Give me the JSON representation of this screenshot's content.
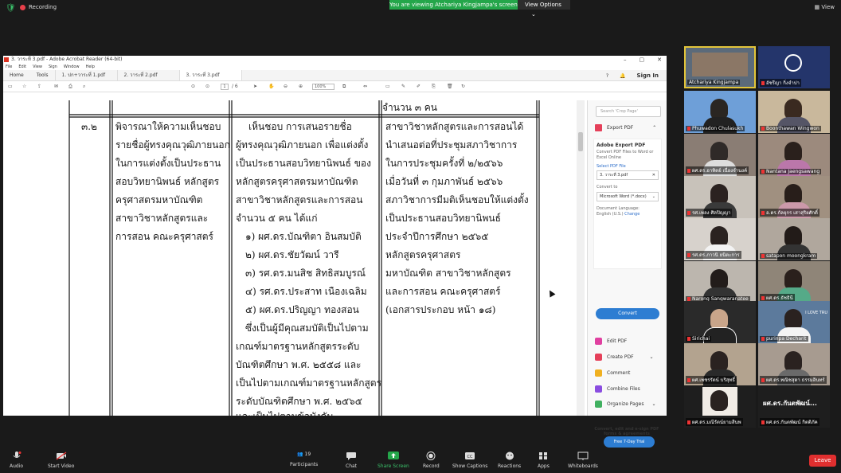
{
  "zoom": {
    "recording_label": "Recording",
    "share_banner": "You are viewing Atchariya Kingjampa's screen",
    "view_options": "View Options",
    "view_label": "View",
    "bottom_bar": {
      "audio": "Audio",
      "video": "Start Video",
      "participants": "Participants",
      "participants_count": "19",
      "chat": "Chat",
      "share": "Share Screen",
      "record": "Record",
      "captions": "Show Captions",
      "reactions": "Reactions",
      "apps": "Apps",
      "whiteboards": "Whiteboards",
      "leave": "Leave"
    },
    "participants": [
      {
        "name": "Atchariya Kingjampa"
      },
      {
        "name": "อัชรีญา กิ่งจำปา"
      },
      {
        "name": "Phuwadon Chulasukh"
      },
      {
        "name": "Boonthawan Wingwon"
      },
      {
        "name": "ผศ.ดร.อาทิตย์ เนื่องจำนงค์"
      },
      {
        "name": "Nantana Jaengsawang"
      },
      {
        "name": "รศ.เพลง ศิลปิญญา"
      },
      {
        "name": "อ.ดร.กัลยุกร เสาสุริยศักดิ์"
      },
      {
        "name": "รศ.ดร.ภาวนิ ยนิตะการ"
      },
      {
        "name": "satapon moongkram"
      },
      {
        "name": "Narong Sangwaranatee"
      },
      {
        "name": "ผศ.ดร.ธัชธินี"
      },
      {
        "name": "Sirichai"
      },
      {
        "name": "purinpa Decharit"
      },
      {
        "name": "ผศ.เพชรรัตน์ บริสุทธิ์"
      },
      {
        "name": "ผศ.ดร.พณิชสุดา ธรรมอินทร์"
      },
      {
        "name": "ผศ.ดร.มณีรัตน์ยามสีนพ"
      },
      {
        "name": "ผศ.ดร.กันตพัฒน์ กิตติภัค"
      }
    ],
    "participant_tile_text": {
      "love": "I LOVE TRU",
      "initials": "ผศ.ดร.กันตพัฒน์..."
    }
  },
  "acrobat": {
    "window_title": "3. วาระที่ 3.pdf - Adobe Acrobat Reader (64-bit)",
    "menu": [
      "File",
      "Edit",
      "View",
      "Sign",
      "Window",
      "Help"
    ],
    "nav": [
      "Home",
      "Tools"
    ],
    "tabs": [
      "1. ปก+วาระที่ 1.pdf",
      "2. วาระที่ 2.pdf",
      "3. วาระที่ 3.pdf"
    ],
    "sign_in": "Sign In",
    "page_current": "1",
    "page_total": "/ 6",
    "zoom": "100%",
    "right_pane": {
      "search_placeholder": "Search 'Crop Page'",
      "export_pdf": "Export PDF",
      "box_title": "Adobe Export PDF",
      "box_subtitle": "Convert PDF Files to Word or Excel Online",
      "select_label": "Select PDF File",
      "file_name": "3. วาระที่ 3.pdf",
      "convert_to": "Convert to",
      "format": "Microsoft Word (*.docx)",
      "doc_language": "Document Language:",
      "language_value": "English (U.S.)",
      "change": "Change",
      "convert_button": "Convert",
      "tools": [
        "Edit PDF",
        "Create PDF",
        "Comment",
        "Combine Files",
        "Organize Pages"
      ],
      "promo": "Convert, edit and e-sign PDF forms & agreements",
      "trial": "Free 7-Day Trial"
    }
  },
  "document": {
    "col3_top": "จำนวน ๓ คน",
    "item_no": "๓.๒",
    "col1_lines": [
      "พิจารณาให้ความเห็นชอบ",
      "รายชื่อผู้ทรงคุณวุฒิภายนอก",
      "ในการแต่งตั้งเป็นประธาน",
      "สอบวิทยานิพนธ์ หลักสูตร",
      "ครุศาสตรมหาบัณฑิต",
      "สาขาวิชาหลักสูตรและ",
      "การสอน คณะครุศาสตร์"
    ],
    "col2_lines": [
      "เห็นชอบ การเสนอรายชื่อ",
      "ผู้ทรงคุณวุฒิภายนอก เพื่อแต่งตั้ง",
      "เป็นประธานสอบวิทยานิพนธ์ ของ",
      "หลักสูตรครุศาสตรมหาบัณฑิต",
      "สาขาวิชาหลักสูตรและการสอน",
      "จำนวน ๕ คน ได้แก่"
    ],
    "col2_list": [
      "๑) ผศ.ดร.บัณฑิตา  อินสมบัติ",
      "๒) ผศ.ดร.ชัยวัฒน์  วารี",
      "๓) รศ.ดร.มนสิช  สิทธิสมบูรณ์",
      "๔) รศ.ดร.ประสาท  เนืองเฉลิม",
      "๕) ผศ.ดร.ปริญญา  ทองสอน"
    ],
    "col2_tail": [
      "ซึ่งเป็นผู้มีคุณสมบัติเป็นไปตาม",
      "เกณฑ์มาตรฐานหลักสูตรระดับ",
      "บัณฑิตศึกษา พ.ศ. ๒๕๕๘ และ",
      "เป็นไปตามเกณฑ์มาตรฐานหลักสูตร",
      "ระดับบัณฑิตศึกษา พ.ศ. ๒๕๖๕",
      "และเป็นไปตามข้อบังคับ"
    ],
    "col3_lines": [
      "สาขาวิชาหลักสูตรและการสอนได้",
      "นำเสนอต่อที่ประชุมสภาวิชาการ",
      "ในการประชุมครั้งที่ ๒/๒๕๖๖",
      "เมื่อวันที่ ๓ กุมภาพันธ์ ๒๕๖๖",
      "สภาวิชาการมีมติเห็นชอบให้แต่งตั้ง",
      "เป็นประธานสอบวิทยานิพนธ์",
      "ประจำปีการศึกษา ๒๕๖๕",
      "หลักสูตรครุศาสตร",
      "มหาบัณฑิต สาขาวิชาหลักสูตร",
      "และการสอน คณะครุศาสตร์",
      "(เอกสารประกอบ หน้า ๑๘)"
    ]
  },
  "colors": {
    "zoom_bg": "#1a1a1a",
    "share_green": "#24a64a",
    "acrobat_blue": "#2d7dd2",
    "leave_red": "#e02f2f"
  }
}
